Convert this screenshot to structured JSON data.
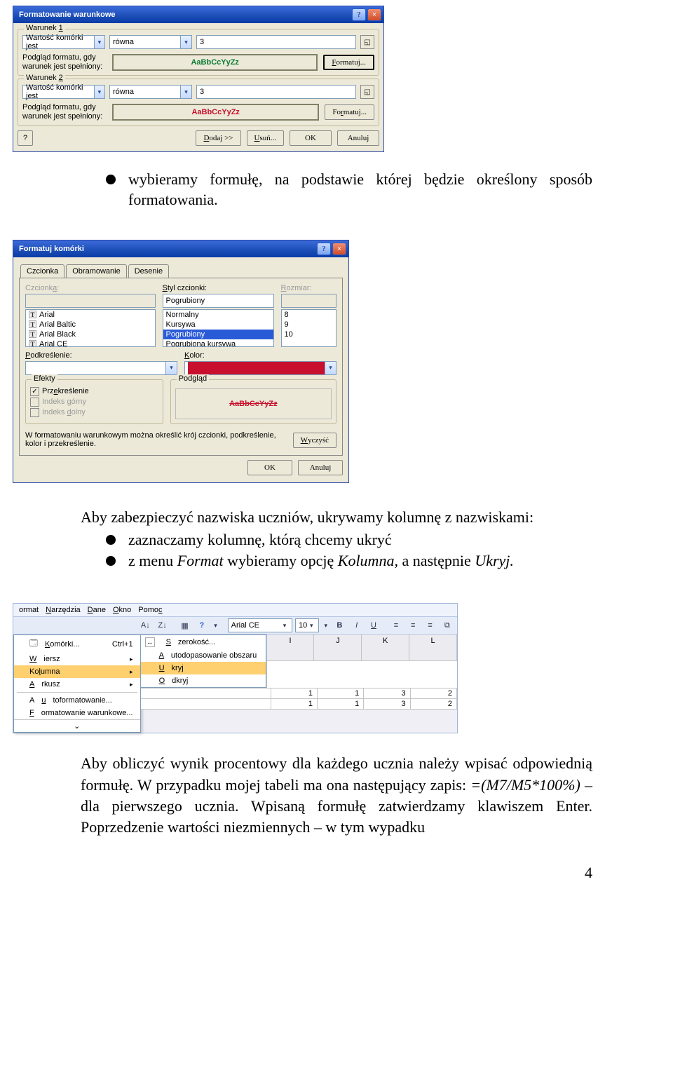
{
  "dialog1": {
    "title": "Formatowanie warunkowe",
    "help_btn": "?",
    "close_btn": "×",
    "condition_prefix": "Warunek",
    "cond_nums": [
      "1",
      "2"
    ],
    "cell_value_is": "Wartość komórki jest",
    "operator": "równa",
    "value": "3",
    "preview_label": "Podgląd formatu, gdy warunek jest spełniony:",
    "preview_text": "AaBbCcYyZz",
    "format_btn": "Formatuj...",
    "add_btn": "Dodaj >>",
    "remove_btn": "Usuń...",
    "ok_btn": "OK",
    "cancel_btn": "Anuluj",
    "help_small": "?"
  },
  "bullet1": "wybieramy formułę, na podstawie której będzie określony sposób formatowania.",
  "dialog2": {
    "title": "Formatuj komórki",
    "tabs": [
      "Czcionka",
      "Obramowanie",
      "Desenie"
    ],
    "font_label": "Czcionka:",
    "style_label": "Styl czcionki:",
    "style_value": "Pogrubiony",
    "size_label": "Rozmiar:",
    "font_list": [
      "Arial",
      "Arial Baltic",
      "Arial Black",
      "Arial CE"
    ],
    "style_list": [
      "Normalny",
      "Kursywa",
      "Pogrubiony",
      "Pogrubiona kursywa"
    ],
    "size_list": [
      "8",
      "9",
      "10"
    ],
    "underline_label": "Podkreślenie:",
    "color_label": "Kolor:",
    "effects_label": "Efekty",
    "preview_label": "Podgląd",
    "strike": "Przekreślenie",
    "sup": "Indeks górny",
    "sub": "Indeks dolny",
    "preview_text": "AaBbCcYyZz",
    "desc": "W formatowaniu warunkowym można określić krój czcionki, podkreślenie, kolor i przekreślenie.",
    "clear_btn": "Wyczyść",
    "ok_btn": "OK",
    "cancel_btn": "Anuluj"
  },
  "text2_intro": "Aby zabezpieczyć nazwiska uczniów, ukrywamy kolumnę z nazwiskami:",
  "bullets2": [
    "zaznaczamy kolumnę, którą chcemy ukryć",
    "z menu Format wybieramy opcję Kolumna, a następnie Ukryj."
  ],
  "italic_words": {
    "format": "Format",
    "kolumna": "Kolumna,",
    "ukryj": "Ukryj."
  },
  "menu": {
    "bar": [
      "ormat",
      "Narzędzia",
      "Dane",
      "Okno",
      "Pomoc"
    ],
    "tool_az": "A↓Z",
    "tool_za": "Z↓A",
    "tool_chart": "▦",
    "tool_help": "?",
    "font_name": "Arial CE",
    "font_size": "10",
    "bold": "B",
    "italic": "I",
    "under": "U",
    "main_items": [
      {
        "label": "Komórki...",
        "accel": "Ctrl+1"
      },
      {
        "label": "Wiersz"
      },
      {
        "label": "Kolumna",
        "sel": true
      },
      {
        "label": "Arkusz"
      },
      {
        "sep": true
      },
      {
        "label": "Autoformatowanie..."
      },
      {
        "label": "Formatowanie warunkowe..."
      }
    ],
    "sub_items": [
      {
        "label": "Szerokość...",
        "icon": "↔"
      },
      {
        "label": "Autodopasowanie obszaru"
      },
      {
        "label": "Ukryj",
        "sel": true
      },
      {
        "label": "Odkryj"
      }
    ],
    "cols": [
      "I",
      "J",
      "K",
      "L"
    ],
    "rows": [
      [
        "1",
        "1",
        "3",
        "2"
      ],
      [
        "1",
        "1",
        "3",
        "2"
      ]
    ],
    "chevron": "⌄"
  },
  "para": "Aby obliczyć wynik procentowy dla każdego ucznia należy wpisać odpowiednią formułę. W przypadku mojej tabeli ma ona następujący zapis: =(M7/M5*100%) – dla pierwszego ucznia. Wpisaną formułę zatwierdzamy klawiszem Enter. Poprzedzenie wartości niezmiennych – w tym wypadku",
  "formula": "=(M7/M5*100%)",
  "pagenum": "4"
}
